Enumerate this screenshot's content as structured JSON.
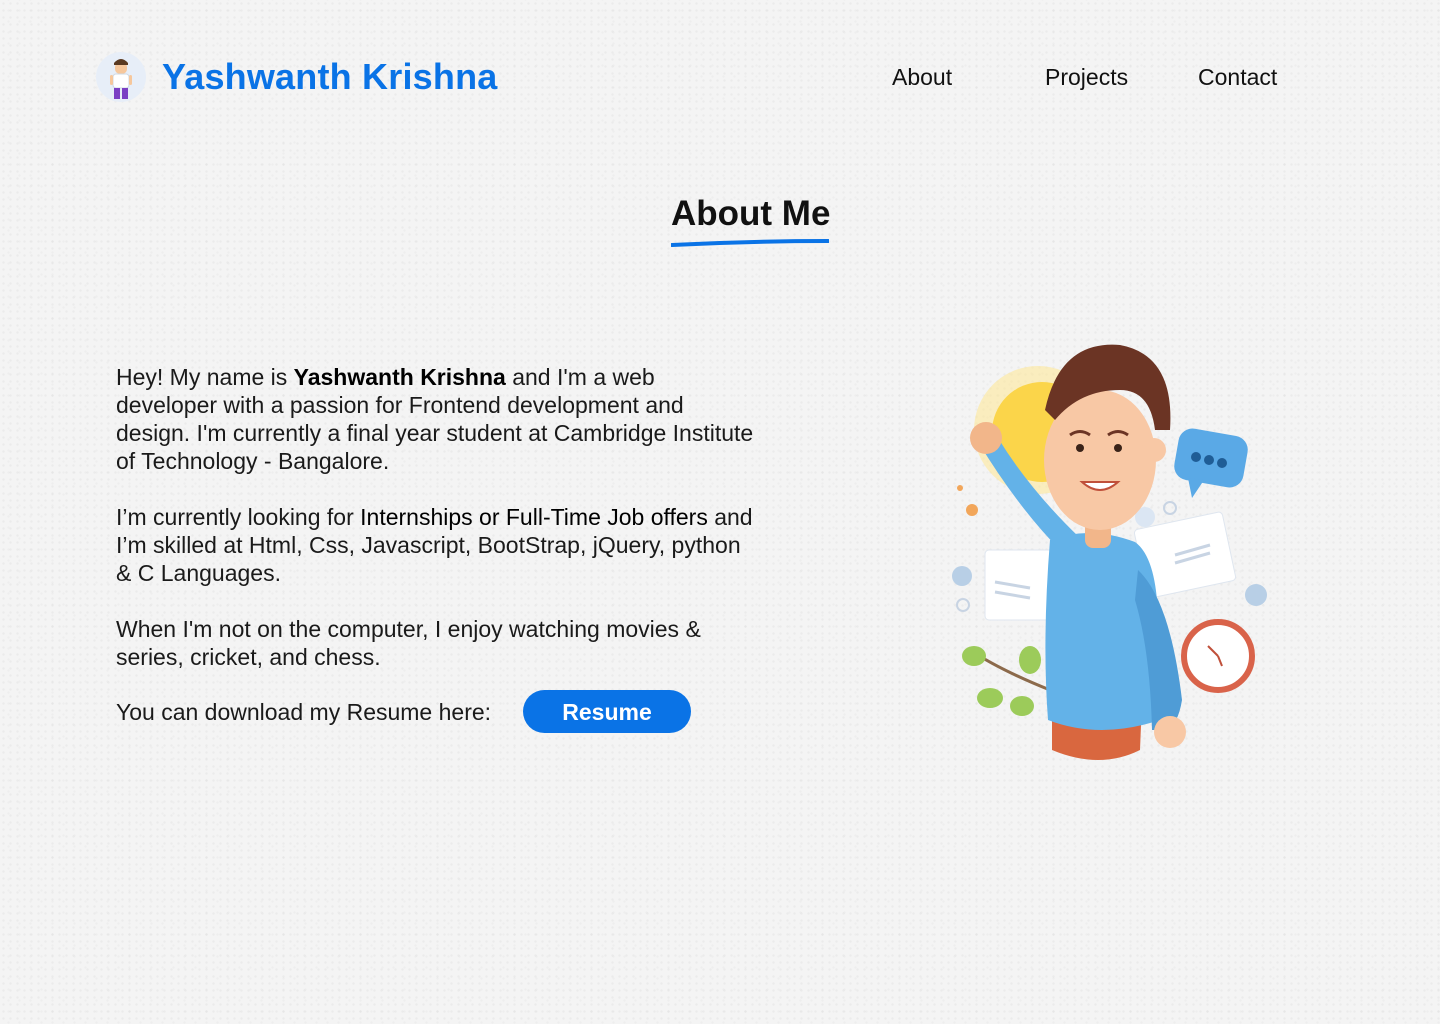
{
  "header": {
    "brand": "Yashwanth Krishna",
    "nav": [
      "About",
      "Projects",
      "Contact"
    ]
  },
  "about": {
    "title": "About Me",
    "para1": {
      "pre": "Hey! My name is ",
      "name": "Yashwanth Krishna",
      "post": " and I'm a web developer with a passion for Frontend development and design. I'm currently a final year student at Cambridge Institute of Technology - Bangalore."
    },
    "para2": {
      "pre": "I’m currently looking for ",
      "highlight": "Internships or Full-Time Job offers",
      "post": " and I’m skilled at Html, Css, Javascript, BootStrap, jQuery, python & C Languages."
    },
    "para3": "When I'm not on the computer, I enjoy watching movies & series, cricket, and chess.",
    "resume_text": "You can download my Resume here:",
    "resume_button": "Resume"
  },
  "colors": {
    "accent": "#0a73e6",
    "background": "#f4f4f4"
  },
  "icons": {
    "logo": "avatar-boy-icon",
    "illustration": "developer-boy-illustration"
  }
}
